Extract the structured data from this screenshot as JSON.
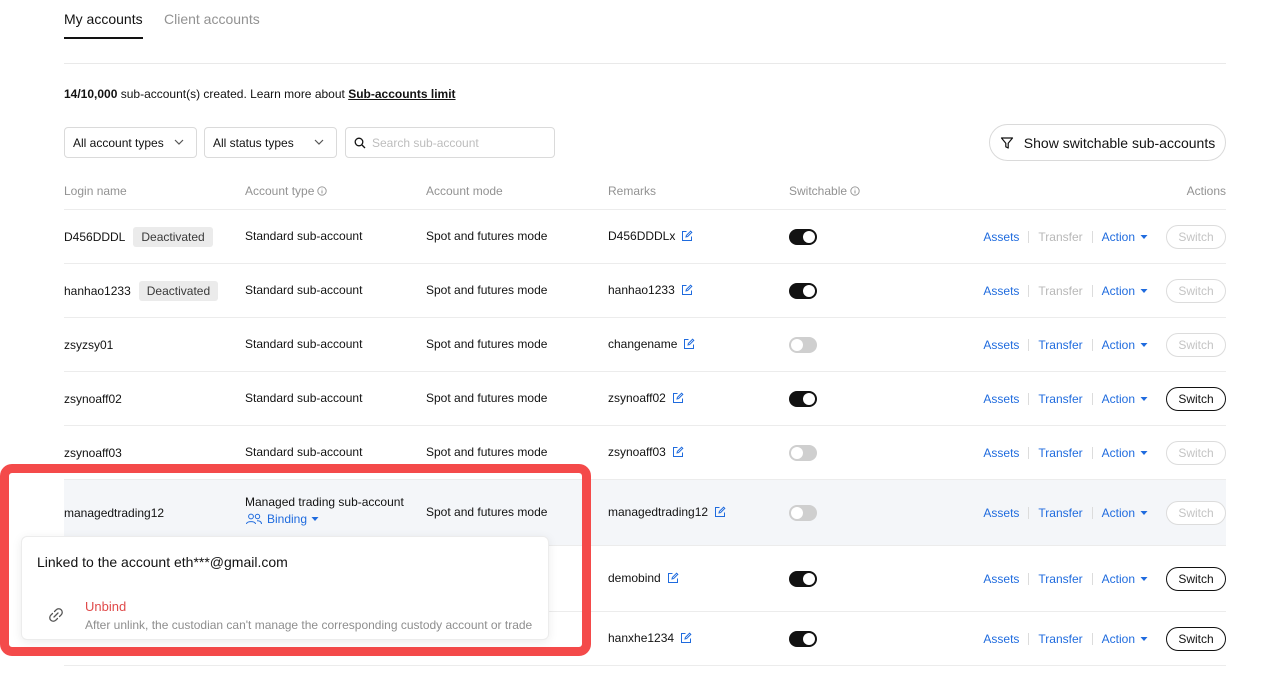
{
  "tabs": [
    {
      "label": "My accounts",
      "active": true
    },
    {
      "label": "Client accounts",
      "active": false
    }
  ],
  "limit": {
    "count": "14/10,000",
    "text": " sub-account(s) created. Learn more about ",
    "link": "Sub-accounts limit"
  },
  "filters": {
    "account_types": "All account types",
    "status_types": "All status types",
    "search_placeholder": "Search sub-account",
    "show_switchable": "Show switchable sub-accounts"
  },
  "columns": {
    "login_name": "Login name",
    "account_type": "Account type",
    "account_mode": "Account mode",
    "remarks": "Remarks",
    "switchable": "Switchable",
    "actions": "Actions"
  },
  "action_labels": {
    "assets": "Assets",
    "transfer": "Transfer",
    "action": "Action",
    "switch": "Switch"
  },
  "rows": [
    {
      "login": "D456DDDL",
      "badge": "Deactivated",
      "type": "Standard sub-account",
      "mode": "Spot and futures mode",
      "remark": "D456DDDLx",
      "switchable": true,
      "transfer_enabled": false,
      "switch_enabled": false
    },
    {
      "login": "hanhao1233",
      "badge": "Deactivated",
      "type": "Standard sub-account",
      "mode": "Spot and futures mode",
      "remark": "hanhao1233",
      "switchable": true,
      "transfer_enabled": false,
      "switch_enabled": false
    },
    {
      "login": "zsyzsy01",
      "badge": "",
      "type": "Standard sub-account",
      "mode": "Spot and futures mode",
      "remark": "changename",
      "switchable": false,
      "transfer_enabled": true,
      "switch_enabled": false
    },
    {
      "login": "zsynoaff02",
      "badge": "",
      "type": "Standard sub-account",
      "mode": "Spot and futures mode",
      "remark": "zsynoaff02",
      "switchable": true,
      "transfer_enabled": true,
      "switch_enabled": true
    },
    {
      "login": "zsynoaff03",
      "badge": "",
      "type": "Standard sub-account",
      "mode": "Spot and futures mode",
      "remark": "zsynoaff03",
      "switchable": false,
      "transfer_enabled": true,
      "switch_enabled": false
    },
    {
      "login": "managedtrading12",
      "badge": "",
      "type": "Managed trading sub-account",
      "binding": "Binding",
      "mode": "Spot and futures mode",
      "remark": "managedtrading12",
      "switchable": false,
      "transfer_enabled": true,
      "switch_enabled": false
    },
    {
      "login": "",
      "badge": "",
      "type": "",
      "mode": "",
      "remark": "demobind",
      "switchable": true,
      "transfer_enabled": true,
      "switch_enabled": true
    },
    {
      "login": "",
      "badge": "",
      "type": "",
      "mode": "",
      "remark": "hanxhe1234",
      "switchable": true,
      "transfer_enabled": true,
      "switch_enabled": true
    }
  ],
  "popover": {
    "linked_text": "Linked to the account eth***@gmail.com",
    "unbind_title": "Unbind",
    "unbind_desc": "After unlink, the custodian can't manage the corresponding custody account or trade"
  },
  "colors": {
    "accent": "#1f6bde",
    "danger": "#e04a4a",
    "highlight_frame": "#f44a4a"
  }
}
